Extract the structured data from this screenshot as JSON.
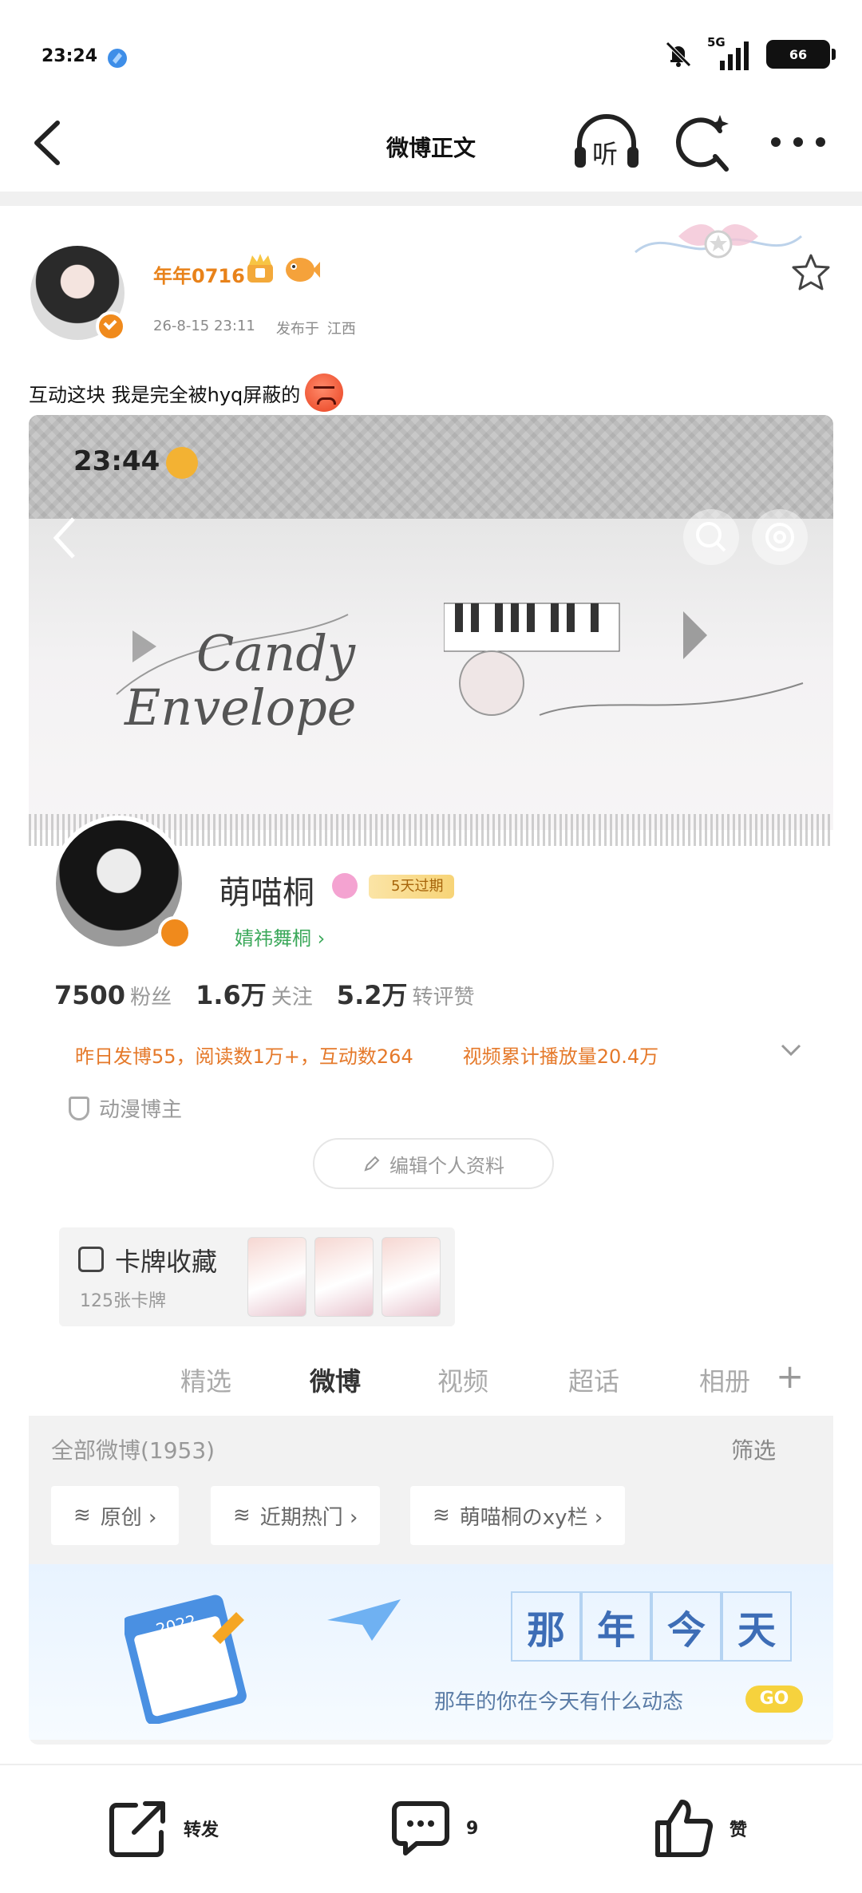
{
  "status_bar": {
    "time": "23:24",
    "network": "5G",
    "battery": "66"
  },
  "nav": {
    "title": "微博正文",
    "listen_label": "听"
  },
  "post": {
    "author": "年年0716",
    "date": "26-8-15 23:11",
    "posted_from_label": "发布于",
    "location": "江西",
    "text": "互动这块 我是完全被hyq屏蔽的"
  },
  "embedded_screenshot": {
    "time": "23:44",
    "banner_title_line1": "Candy",
    "banner_title_line2": "Envelope",
    "profile_name": "萌喵桐",
    "vip_badge": "5天过期",
    "fans_group": "婧祎舞桐 ›",
    "stats": [
      {
        "value": "7500",
        "label": "粉丝"
      },
      {
        "value": "1.6万",
        "label": "关注"
      },
      {
        "value": "5.2万",
        "label": "转评赞"
      }
    ],
    "summary_left": "昨日发博55，阅读数1万+，互动数264",
    "summary_right": "视频累计播放量20.4万",
    "tag": "动漫博主",
    "edit_profile": "编辑个人资料",
    "cards_title": "卡牌收藏",
    "cards_count": "125张卡牌",
    "tabs": [
      "精选",
      "微博",
      "视频",
      "超话",
      "相册"
    ],
    "active_tab": "微博",
    "all_posts": "全部微博(1953)",
    "filter": "筛选",
    "chips": [
      "原创 ›",
      "近期热门 ›",
      "萌喵桐のxy栏 ›"
    ],
    "memory_chars": [
      "那",
      "年",
      "今",
      "天"
    ],
    "memory_subtitle": "那年的你在今天有什么动态",
    "memory_go": "GO",
    "calendar_year": "2022"
  },
  "toolbar": {
    "repost_label": "转发",
    "comment_count": "9",
    "like_label": "赞"
  },
  "colors": {
    "accent_orange": "#e8821a",
    "summary_orange": "#e5792a",
    "verified_orange": "#f08a1c",
    "fans_green": "#3ba85a"
  }
}
